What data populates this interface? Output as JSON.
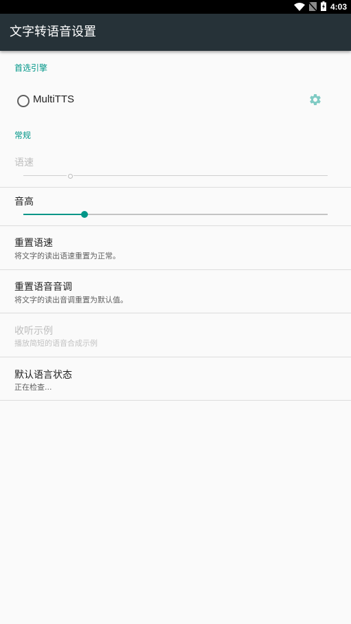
{
  "status_bar": {
    "time": "4:03",
    "icons": [
      "wifi-icon",
      "no-sim-icon",
      "battery-charging-icon"
    ]
  },
  "toolbar": {
    "title": "文字转语音设置"
  },
  "preferred_engine": {
    "header": "首选引擎",
    "engine_label": "MultiTTS",
    "settings_icon": "gear-icon"
  },
  "general": {
    "header": "常规",
    "speech_rate": {
      "label": "语速",
      "level": 0.15,
      "enabled": false
    },
    "pitch": {
      "label": "音高",
      "level": 0.2,
      "enabled": true
    },
    "reset_rate": {
      "title": "重置语速",
      "summary": "将文字的读出语速重置为正常。"
    },
    "reset_pitch": {
      "title": "重置语音音调",
      "summary": "将文字的读出音调重置为默认值。"
    },
    "listen_example": {
      "title": "收听示例",
      "summary": "播放简短的语音合成示例",
      "enabled": false
    },
    "default_language_status": {
      "title": "默认语言状态",
      "summary": "正在检查..."
    }
  },
  "colors": {
    "accent": "#009688",
    "toolbar": "#263238",
    "status_bar": "#000000",
    "background": "#fafafa"
  }
}
